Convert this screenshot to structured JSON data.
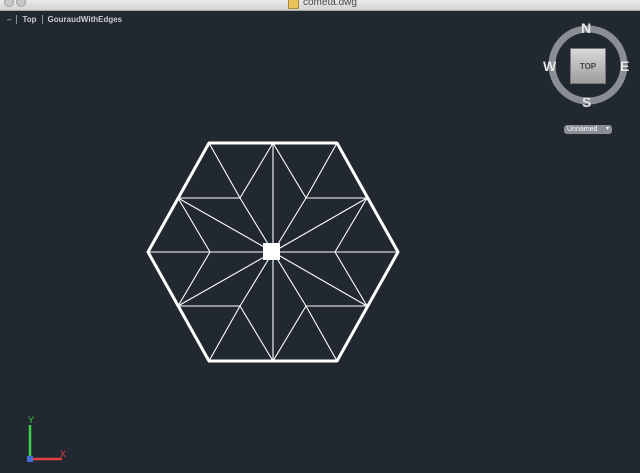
{
  "window": {
    "title": "cometa.dwg"
  },
  "viewport_controls": {
    "menu_label": "–",
    "view_label": "Top",
    "visual_style_label": "GouraudWithEdges"
  },
  "viewcube": {
    "face_label": "TOP",
    "north": "N",
    "south": "S",
    "east": "E",
    "west": "W"
  },
  "ucs_selector": {
    "value": "Unnamed"
  },
  "ucs_icon": {
    "y_label": "Y",
    "x_label": "X"
  },
  "colors": {
    "background": "#212830",
    "linework": "#ffffff",
    "ucs_x": "#e04040",
    "ucs_y": "#3ecf4a"
  }
}
